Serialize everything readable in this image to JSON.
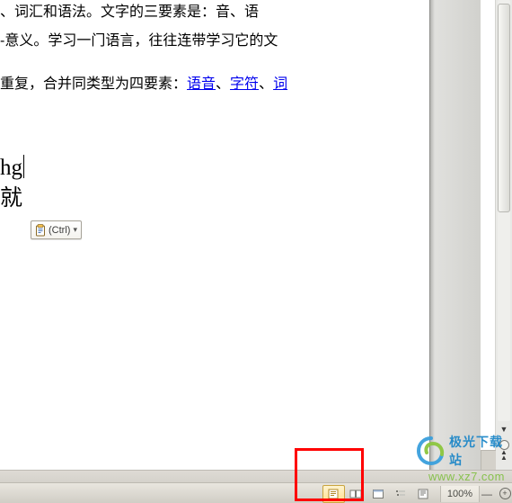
{
  "document": {
    "line1_suffix": "、词汇和语法。文字的三要素是：音、语",
    "line2": "-意义。学习一门语言，往往连带学习它的文",
    "line3_prefix": "重复，合并同类型为四要素：",
    "links": [
      "语音",
      "字符",
      "词"
    ],
    "sep": "、",
    "typed1": "hg",
    "typed2": "就"
  },
  "paste_options": {
    "label": "(Ctrl)"
  },
  "status": {
    "zoom": "100%"
  },
  "view_buttons": {
    "print_layout": "print-layout",
    "full_screen": "full-screen-reading",
    "web_layout": "web-layout",
    "outline": "outline",
    "draft": "draft"
  },
  "watermark": {
    "brand_cn": "极光下载站",
    "url": "www.xz7.com"
  }
}
